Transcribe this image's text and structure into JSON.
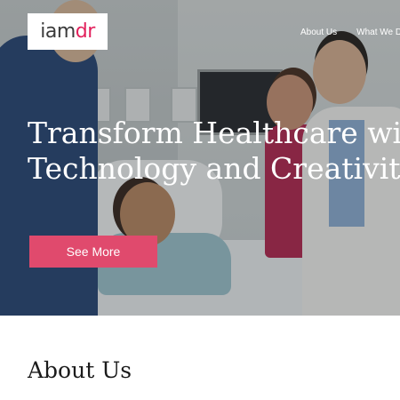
{
  "header": {
    "logo_part1": "iam",
    "logo_part2": "dr",
    "nav": [
      "About Us",
      "What We Do"
    ]
  },
  "hero": {
    "headline_line1": "Transform Healthcare with",
    "headline_line2": "Technology and Creativity",
    "cta_label": "See More"
  },
  "sections": {
    "about_title": "About Us"
  },
  "colors": {
    "brand_pink": "#e2215c",
    "cta_pink": "#e04a6d"
  }
}
